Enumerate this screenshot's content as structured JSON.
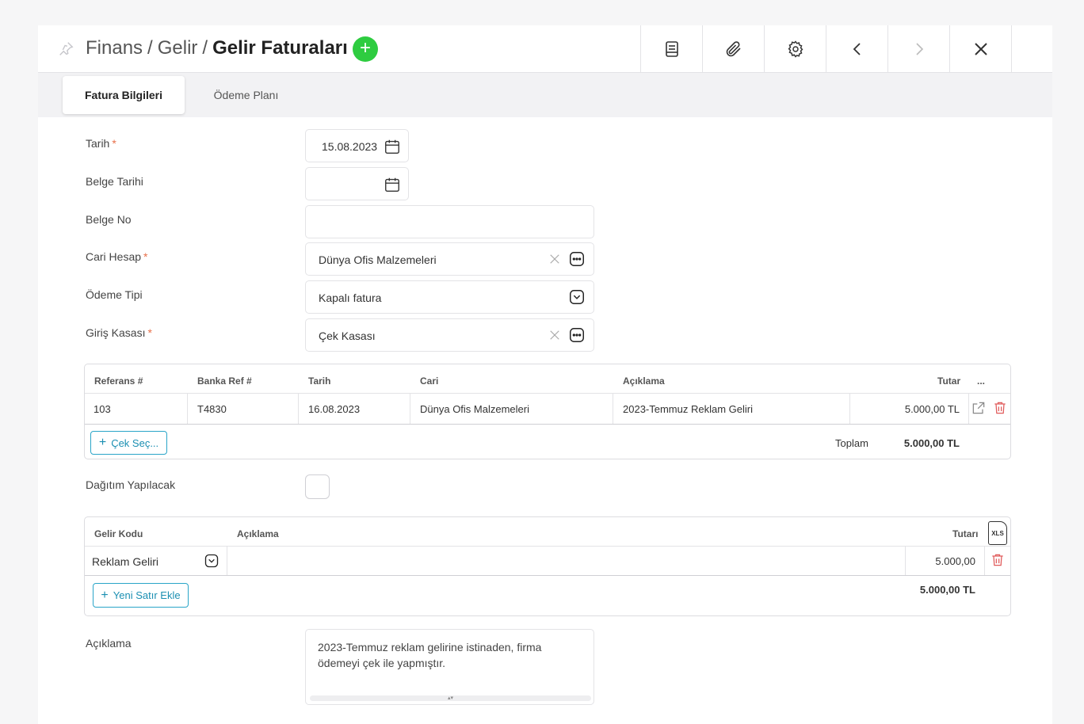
{
  "header": {
    "breadcrumb": [
      "Finans",
      "Gelir"
    ],
    "separator": "/",
    "title": "Gelir Faturaları",
    "add_symbol": "+"
  },
  "toolbar": {
    "icons": [
      "print-icon",
      "paperclip-icon",
      "gear-icon",
      "chevron-left-icon",
      "chevron-right-icon",
      "close-icon"
    ]
  },
  "tabs": [
    {
      "label": "Fatura Bilgileri",
      "active": true
    },
    {
      "label": "Ödeme Planı",
      "active": false
    }
  ],
  "form": {
    "required_mark": "*",
    "tarih": {
      "label": "Tarih",
      "value": "15.08.2023"
    },
    "belge_tarihi": {
      "label": "Belge Tarihi",
      "value": ""
    },
    "belge_no": {
      "label": "Belge No",
      "value": ""
    },
    "cari_hesap": {
      "label": "Cari Hesap",
      "value": "Dünya Ofis Malzemeleri"
    },
    "odeme_tipi": {
      "label": "Ödeme Tipi",
      "value": "Kapalı fatura"
    },
    "giris_kasasi": {
      "label": "Giriş Kasası",
      "value": "Çek Kasası"
    },
    "dagitim": {
      "label": "Dağıtım Yapılacak",
      "checked": false
    },
    "aciklama": {
      "label": "Açıklama",
      "value": "2023-Temmuz reklam gelirine istinaden, firma ödemeyi çek ile yapmıştır."
    }
  },
  "cheque_table": {
    "columns": [
      "Referans #",
      "Banka Ref #",
      "Tarih",
      "Cari",
      "Açıklama",
      "Tutar",
      "..."
    ],
    "rows": [
      {
        "referans": "103",
        "banka_ref": "T4830",
        "tarih": "16.08.2023",
        "cari": "Dünya Ofis Malzemeleri",
        "aciklama": "2023-Temmuz Reklam Geliri",
        "tutar": "5.000,00 TL"
      }
    ],
    "add_button": "Çek Seç...",
    "total_label": "Toplam",
    "total_value": "5.000,00 TL"
  },
  "income_table": {
    "columns": [
      "Gelir Kodu",
      "Açıklama",
      "Tutarı"
    ],
    "xls_label": "XLS",
    "rows": [
      {
        "gelir_kodu": "Reklam Geliri",
        "aciklama": "",
        "tutar": "5.000,00"
      }
    ],
    "add_button": "Yeni Satır Ekle",
    "total_value": "5.000,00 TL"
  },
  "colors": {
    "accent_green": "#2ecc40",
    "accent_blue": "#1b8fb2",
    "danger": "#e05a5a",
    "required": "#e8704a"
  }
}
